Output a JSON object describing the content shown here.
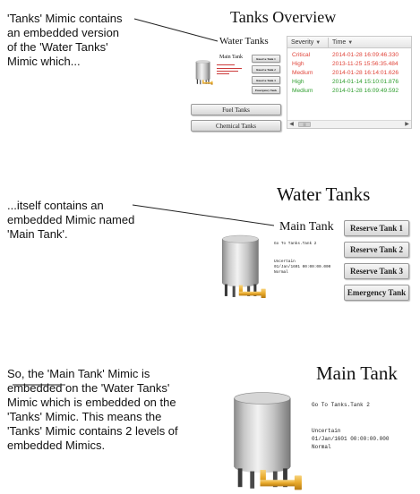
{
  "notes": {
    "note1": "'Tanks' Mimic contains\nan embedded version\nof the 'Water Tanks'\nMimic which...",
    "note2": "...itself contains an\nembedded Mimic  named\n'Main Tank'.",
    "note3": "So, the 'Main Tank' Mimic is\nembedded on the 'Water Tanks'\nMimic which is embedded on the\n'Tanks' Mimic. This means the\n'Tanks' Mimic contains 2 levels of\nembedded Mimics."
  },
  "tanks_overview": {
    "title": "Tanks Overview",
    "water_tanks_title": "Water Tanks",
    "main_tank_title": "Main Tank",
    "buttons": [
      "Reserve Tank 1",
      "Reserve Tank 2",
      "Reserve Tank 3",
      "Emergency Tank"
    ],
    "fuel_tanks_label": "Fuel Tanks",
    "chemical_tanks_label": "Chemical Tanks",
    "alarm_grid": {
      "columns": [
        "Severity",
        "Time"
      ],
      "rows": [
        {
          "severity": "Critical",
          "time": "2014-01-28 16:09:46.330",
          "color": "#e0443a"
        },
        {
          "severity": "High",
          "time": "2013-11-25 15:56:35.484",
          "color": "#e0443a"
        },
        {
          "severity": "Medium",
          "time": "2014-01-28 16:14:01.626",
          "color": "#e0443a"
        },
        {
          "severity": "High",
          "time": "2014-01-14 15:10:01.876",
          "color": "#2f9e2f"
        },
        {
          "severity": "Medium",
          "time": "2014-01-28 16:09:49.592",
          "color": "#2f9e2f"
        }
      ]
    }
  },
  "water_tanks": {
    "title": "Water Tanks",
    "main_tank_title": "Main Tank",
    "buttons": [
      "Reserve Tank 1",
      "Reserve Tank 2",
      "Reserve Tank 3",
      "Emergency Tank"
    ],
    "main_tank_lines": [
      "Go To Tanks.Tank 2",
      "Uncertain",
      "01/Jan/1601 00:00:00.000",
      "Normal"
    ]
  },
  "main_tank": {
    "title": "Main Tank",
    "lines": [
      "Go To Tanks.Tank 2",
      "Uncertain",
      "01/Jan/1601 00:00:00.000",
      "Normal"
    ]
  },
  "colors": {
    "critical": "#e0443a",
    "ok": "#2f9e2f",
    "pipe": "#e8a92a"
  }
}
